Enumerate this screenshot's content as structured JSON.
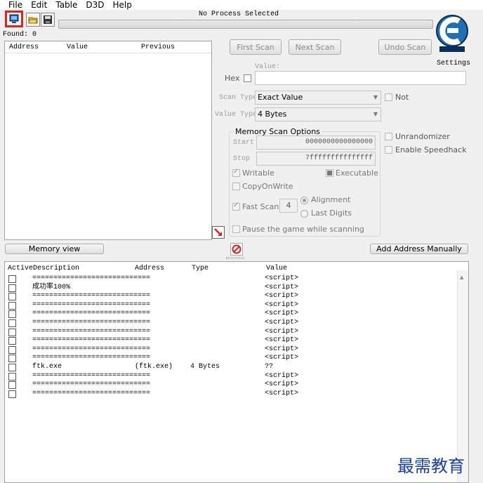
{
  "menu": {
    "items": [
      "File",
      "Edit",
      "Table",
      "D3D",
      "Help"
    ]
  },
  "toolbar": {
    "process_title": "No Process Selected",
    "open_process_icon": "computer-select-icon",
    "open_file_icon": "folder-open-icon",
    "save_icon": "save-disk-icon"
  },
  "found_count": "Found: 0",
  "found_list": {
    "columns": [
      "Address",
      "Value",
      "Previous"
    ]
  },
  "scan": {
    "first_scan": "First Scan",
    "next_scan": "Next Scan",
    "undo_scan": "Undo Scan",
    "settings_label": "Settings",
    "value_label": "Value:",
    "hex_label": "Hex",
    "scan_type_label": "Scan Type",
    "scan_type_value": "Exact Value",
    "not_label": "Not",
    "value_type_label": "Value Type",
    "value_type_value": "4 Bytes"
  },
  "memory_options": {
    "title": "Memory Scan Options",
    "start_label": "Start",
    "start_value": "0000000000000000",
    "stop_label": "Stop",
    "stop_value": "7fffffffffffffff",
    "writable": "Writable",
    "executable": "Executable",
    "copy_on_write": "CopyOnWrite",
    "fast_scan": "Fast Scan",
    "fast_scan_value": "4",
    "alignment": "Alignment",
    "last_digits": "Last Digits",
    "pause_game": "Pause the game while scanning"
  },
  "extra_options": {
    "unrandomizer": "Unrandomizer",
    "speedhack": "Enable Speedhack"
  },
  "bottom_buttons": {
    "memory_view": "Memory view",
    "add_address": "Add Address Manually"
  },
  "address_list": {
    "columns": [
      "Active",
      "Description",
      "Address",
      "Type",
      "Value"
    ],
    "rows": [
      {
        "description": "============================",
        "address": "",
        "type": "",
        "value": "<script>"
      },
      {
        "description": "成功率100%",
        "address": "",
        "type": "",
        "value": "<script>"
      },
      {
        "description": "============================",
        "address": "",
        "type": "",
        "value": "<script>"
      },
      {
        "description": "============================",
        "address": "",
        "type": "",
        "value": "<script>"
      },
      {
        "description": "============================",
        "address": "",
        "type": "",
        "value": "<script>"
      },
      {
        "description": "============================",
        "address": "",
        "type": "",
        "value": "<script>"
      },
      {
        "description": "============================",
        "address": "",
        "type": "",
        "value": "<script>"
      },
      {
        "description": "============================",
        "address": "",
        "type": "",
        "value": "<script>"
      },
      {
        "description": "============================",
        "address": "",
        "type": "",
        "value": "<script>"
      },
      {
        "description": "============================",
        "address": "",
        "type": "",
        "value": "<script>"
      },
      {
        "description": "ftk.exe",
        "address": "(ftk.exe)",
        "type": "4 Bytes",
        "value": "??"
      },
      {
        "description": "============================",
        "address": "",
        "type": "",
        "value": "<script>"
      },
      {
        "description": "============================",
        "address": "",
        "type": "",
        "value": "<script>"
      },
      {
        "description": "============================",
        "address": "",
        "type": "",
        "value": "<script>"
      }
    ]
  },
  "watermark": "最需教育",
  "colors": {
    "highlight_border": "#d8281e",
    "logo_blue": "#1f6fb2",
    "watermark": "#1a3ea8"
  }
}
